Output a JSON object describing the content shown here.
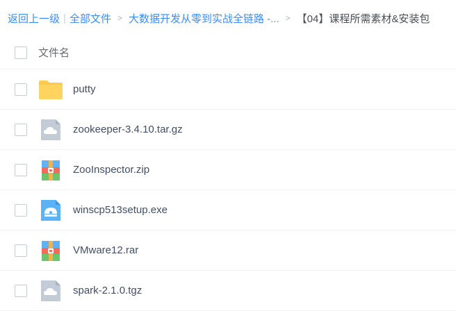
{
  "breadcrumb": {
    "back": "返回上一级",
    "all_files": "全部文件",
    "parent": "大数据开发从零到实战全链路 -...",
    "current": "【04】课程所需素材&安装包",
    "separator_bar": "|",
    "separator_arrow": ">"
  },
  "table": {
    "header": "文件名"
  },
  "files": [
    {
      "name": "putty",
      "icon": "folder-icon"
    },
    {
      "name": "zookeeper-3.4.10.tar.gz",
      "icon": "cloud-file-icon"
    },
    {
      "name": "ZooInspector.zip",
      "icon": "archive-icon"
    },
    {
      "name": "winscp513setup.exe",
      "icon": "installer-icon"
    },
    {
      "name": "VMware12.rar",
      "icon": "archive-icon"
    },
    {
      "name": "spark-2.1.0.tgz",
      "icon": "cloud-file-icon"
    }
  ],
  "colors": {
    "link": "#3b8cff",
    "folder": "#ffc94d",
    "cloud_file": "#c3ccd6",
    "installer": "#5ab2f7"
  }
}
